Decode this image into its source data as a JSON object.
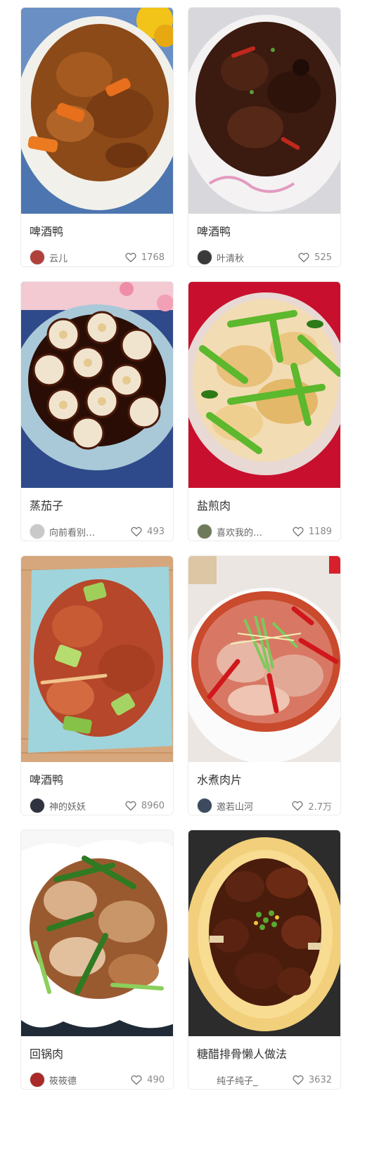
{
  "feed": {
    "cards": [
      {
        "title": "啤酒鸭",
        "author": "云儿",
        "likes": "1768",
        "photo": "braised-duck-carrot-dish",
        "avatar_color": "#b0403a"
      },
      {
        "title": "啤酒鸭",
        "author": "叶清秋",
        "likes": "525",
        "photo": "dark-braised-duck-star-anise-dish",
        "avatar_color": "#3a3a3a"
      },
      {
        "title": "蒸茄子",
        "author": "向前看别…",
        "likes": "493",
        "photo": "steamed-eggplant-garlic-plate",
        "avatar_color": "#c9c9c9"
      },
      {
        "title": "盐煎肉",
        "author": "喜欢我的…",
        "likes": "1189",
        "photo": "pan-fried-pork-scallion-plate",
        "avatar_color": "#6f7a5a"
      },
      {
        "title": "啤酒鸭",
        "author": "神的妖妖",
        "likes": "8960",
        "photo": "duck-green-pepper-plate",
        "avatar_color": "#2f3340"
      },
      {
        "title": "水煮肉片",
        "author": "邀若山河",
        "likes": "2.7万",
        "photo": "boiled-pork-slices-bowl",
        "avatar_color": "#3b4a5c"
      },
      {
        "title": "回锅肉",
        "author": "筱筱德",
        "likes": "490",
        "photo": "twice-cooked-pork-plate",
        "avatar_color": "#a82a2a"
      },
      {
        "title": "糖醋排骨懒人做法",
        "author": "纯子纯子_",
        "likes": "3632",
        "photo": "sweet-sour-ribs-plate",
        "avatar_color": ""
      }
    ]
  },
  "icons": {
    "like": "heart-outline-icon"
  },
  "colors": {
    "title_text": "#333333",
    "meta_text": "#666666",
    "card_border": "#ececec"
  }
}
